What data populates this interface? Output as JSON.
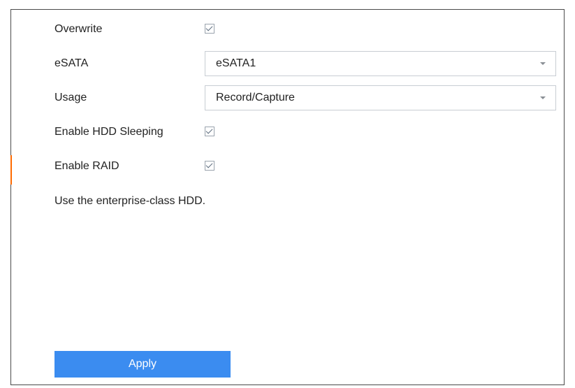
{
  "form": {
    "overwrite": {
      "label": "Overwrite",
      "checked": true
    },
    "esata": {
      "label": "eSATA",
      "selected": "eSATA1"
    },
    "usage": {
      "label": "Usage",
      "selected": "Record/Capture"
    },
    "hdd_sleeping": {
      "label": "Enable HDD Sleeping",
      "checked": true
    },
    "raid": {
      "label": "Enable RAID",
      "checked": true
    },
    "note": "Use the enterprise-class HDD."
  },
  "actions": {
    "apply_label": "Apply"
  },
  "colors": {
    "accent": "#ff6a00",
    "primary_button": "#3b8cf0",
    "frame_border": "#4a4a4a"
  }
}
